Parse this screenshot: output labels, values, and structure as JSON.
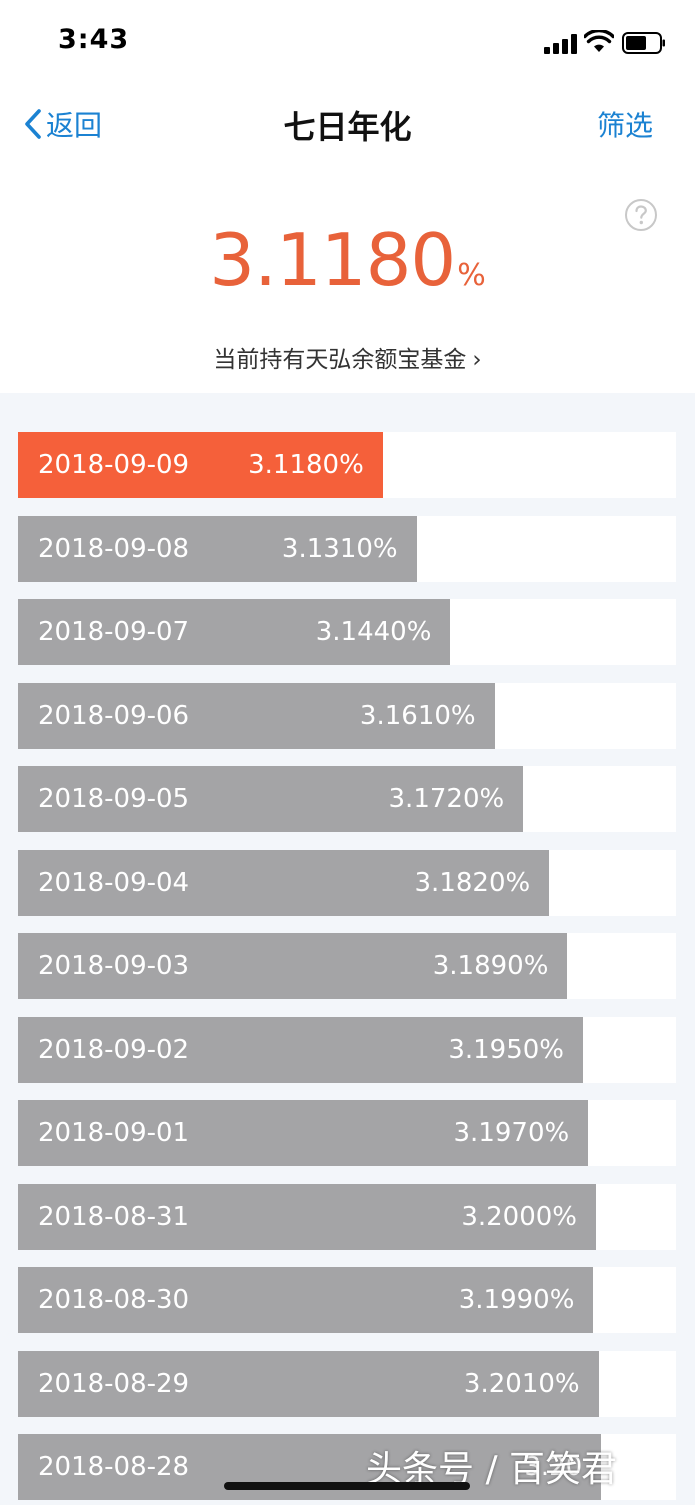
{
  "status_bar": {
    "time": "3:43"
  },
  "nav": {
    "back_label": "返回",
    "title": "七日年化",
    "filter_label": "筛选"
  },
  "summary": {
    "rate_number": "3.1180",
    "rate_unit": "%",
    "fund_link": "当前持有天弘余额宝基金",
    "chevron": "›"
  },
  "rates": [
    {
      "date": "2018-09-09",
      "label": "3.1180%",
      "value": 3.118,
      "active": true
    },
    {
      "date": "2018-09-08",
      "label": "3.1310%",
      "value": 3.131
    },
    {
      "date": "2018-09-07",
      "label": "3.1440%",
      "value": 3.144
    },
    {
      "date": "2018-09-06",
      "label": "3.1610%",
      "value": 3.161
    },
    {
      "date": "2018-09-05",
      "label": "3.1720%",
      "value": 3.172
    },
    {
      "date": "2018-09-04",
      "label": "3.1820%",
      "value": 3.182
    },
    {
      "date": "2018-09-03",
      "label": "3.1890%",
      "value": 3.189
    },
    {
      "date": "2018-09-02",
      "label": "3.1950%",
      "value": 3.195
    },
    {
      "date": "2018-09-01",
      "label": "3.1970%",
      "value": 3.197
    },
    {
      "date": "2018-08-31",
      "label": "3.2000%",
      "value": 3.2
    },
    {
      "date": "2018-08-30",
      "label": "3.1990%",
      "value": 3.199
    },
    {
      "date": "2018-08-29",
      "label": "3.2010%",
      "value": 3.201
    },
    {
      "date": "2018-08-28",
      "label": "3.20",
      "value": 3.202
    }
  ],
  "watermark": "头条号 / 百笑君",
  "colors": {
    "accent": "#e8623a",
    "active_bar": "#f5603a",
    "bar": "#a4a4a6",
    "link": "#1b82d2"
  }
}
